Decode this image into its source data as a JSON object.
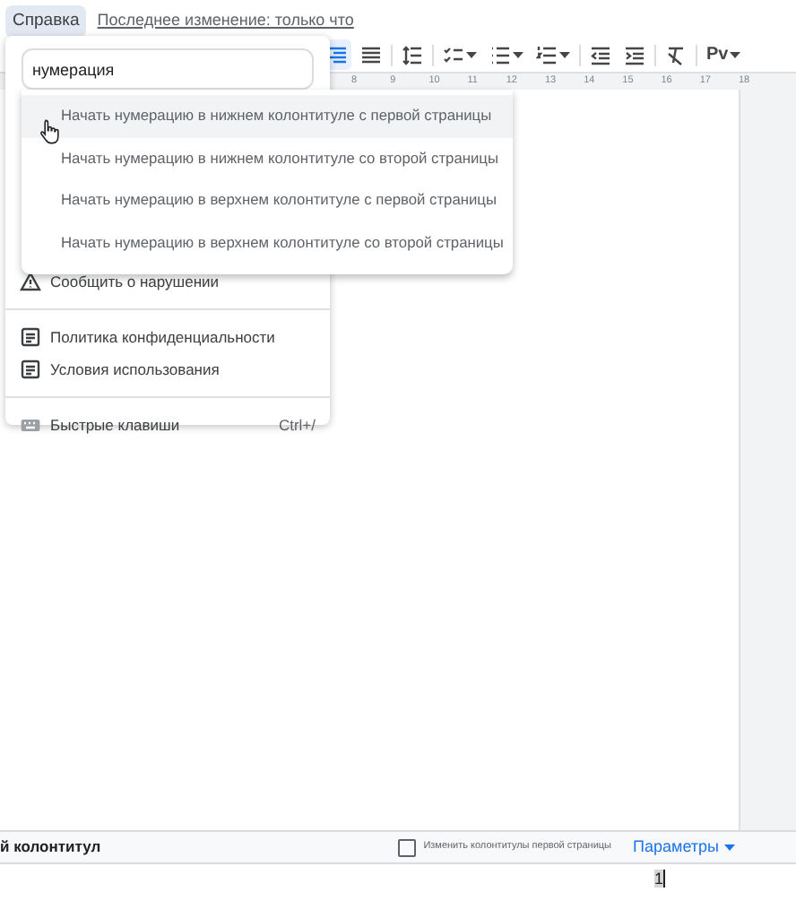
{
  "menu_bar": {
    "menus": [
      {
        "label": "Справка",
        "selected": true
      }
    ],
    "last_edit": "Последнее изменение: только что"
  },
  "toolbar": {
    "alignment": [
      {
        "selected": true
      },
      {
        "selected": false
      }
    ],
    "style_button": "Pv"
  },
  "ruler": [
    "8",
    "9",
    "10",
    "11",
    "12",
    "13",
    "14",
    "15",
    "16",
    "17",
    "18"
  ],
  "help_menu": {
    "search": {
      "value": "нумерация"
    },
    "items": [
      {
        "kind": "report",
        "label": "Сообщить о нарушении"
      },
      {
        "kind": "divider"
      },
      {
        "kind": "document",
        "label": "Политика конфиденциальности"
      },
      {
        "kind": "document",
        "label": "Условия использования"
      },
      {
        "kind": "divider"
      },
      {
        "kind": "shortcuts",
        "label": "Быстрые клавиши",
        "shortcut": "Ctrl+/"
      }
    ]
  },
  "suggestions": [
    {
      "label": "Начать нумерацию в нижнем колонтитуле с первой страницы",
      "selected": true
    },
    {
      "label": "Начать нумерацию в нижнем колонтитуле со второй страницы",
      "selected": false
    },
    {
      "label": "Начать нумерацию в верхнем колонтитуле с первой страницы",
      "selected": false
    },
    {
      "label": "Начать нумерацию в верхнем колонтитуле со второй страницы",
      "selected": false
    }
  ],
  "footer_bar": {
    "title": "й колонтитул",
    "first_page_option": {
      "label": "Изменить колонтитулы первой страницы",
      "checked": false
    },
    "options_button": "Параметры"
  },
  "footer_text": "1"
}
